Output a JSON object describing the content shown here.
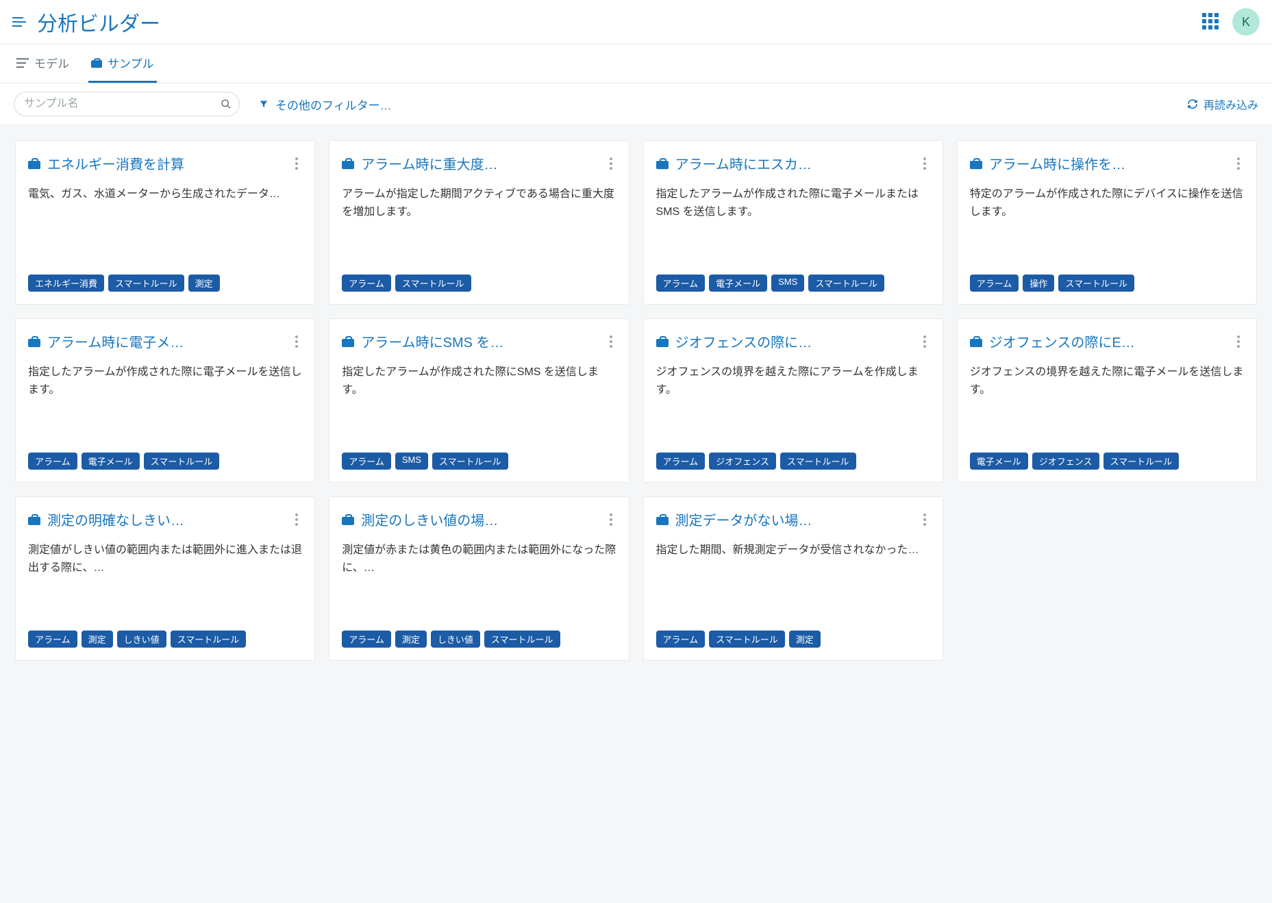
{
  "header": {
    "title": "分析ビルダー",
    "avatar_initial": "K"
  },
  "tabs": [
    {
      "id": "model",
      "label": "モデル",
      "active": false
    },
    {
      "id": "sample",
      "label": "サンプル",
      "active": true
    }
  ],
  "toolbar": {
    "search_placeholder": "サンプル名",
    "filter_label": "その他のフィルター…",
    "reload_label": "再読み込み"
  },
  "cards": [
    {
      "title": "エネルギー消費を計算",
      "description": "電気、ガス、水道メーターから生成されたデータ…",
      "tags": [
        "エネルギー消費",
        "スマートルール",
        "測定"
      ]
    },
    {
      "title": "アラーム時に重大度…",
      "description": "アラームが指定した期間アクティブである場合に重大度を増加します。",
      "tags": [
        "アラーム",
        "スマートルール"
      ]
    },
    {
      "title": "アラーム時にエスカ…",
      "description": "指定したアラームが作成された際に電子メールまたはSMS を送信します。",
      "tags": [
        "アラーム",
        "電子メール",
        "SMS",
        "スマートルール"
      ]
    },
    {
      "title": "アラーム時に操作を…",
      "description": "特定のアラームが作成された際にデバイスに操作を送信します。",
      "tags": [
        "アラーム",
        "操作",
        "スマートルール"
      ]
    },
    {
      "title": "アラーム時に電子メ…",
      "description": "指定したアラームが作成された際に電子メールを送信します。",
      "tags": [
        "アラーム",
        "電子メール",
        "スマートルール"
      ]
    },
    {
      "title": "アラーム時にSMS を…",
      "description": "指定したアラームが作成された際にSMS を送信します。",
      "tags": [
        "アラーム",
        "SMS",
        "スマートルール"
      ]
    },
    {
      "title": "ジオフェンスの際に…",
      "description": "ジオフェンスの境界を越えた際にアラームを作成します。",
      "tags": [
        "アラーム",
        "ジオフェンス",
        "スマートルール"
      ]
    },
    {
      "title": "ジオフェンスの際にE…",
      "description": "ジオフェンスの境界を越えた際に電子メールを送信します。",
      "tags": [
        "電子メール",
        "ジオフェンス",
        "スマートルール"
      ]
    },
    {
      "title": "測定の明確なしきい…",
      "description": "測定値がしきい値の範囲内または範囲外に進入または退出する際に、…",
      "tags": [
        "アラーム",
        "測定",
        "しきい値",
        "スマートルール"
      ]
    },
    {
      "title": "測定のしきい値の場…",
      "description": "測定値が赤または黄色の範囲内または範囲外になった際に、…",
      "tags": [
        "アラーム",
        "測定",
        "しきい値",
        "スマートルール"
      ]
    },
    {
      "title": "測定データがない場…",
      "description": "指定した期間、新規測定データが受信されなかった…",
      "tags": [
        "アラーム",
        "スマートルール",
        "測定"
      ]
    }
  ]
}
